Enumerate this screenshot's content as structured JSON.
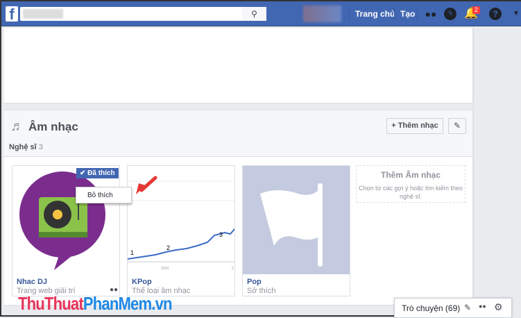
{
  "topbar": {
    "logo": "f",
    "home": "Trang chủ",
    "create": "Tạo",
    "notif_count": "2"
  },
  "music": {
    "title": "Âm nhạc",
    "add_label": "+ Thêm nhạc",
    "tab_label": "Nghệ sĩ",
    "tab_count": "3",
    "tiles": [
      {
        "name": "Nhac DJ",
        "sub": "Trang web giải trí"
      },
      {
        "name": "KPop",
        "sub": "Thể loại âm nhạc",
        "chart_labels": [
          "1",
          "2",
          "3"
        ],
        "axis_label": "2010",
        "axis_label2": "2"
      },
      {
        "name": "Pop",
        "sub": "Sở thích"
      }
    ],
    "add_tile": {
      "title": "Thêm Âm nhạc",
      "desc": "Chọn từ các gợi ý hoặc tìm kiếm theo nghệ sĩ."
    },
    "liked_label": "✔ Đã thích",
    "unlike_label": "Bỏ thích"
  },
  "watermark": {
    "part1": "ThuThuat",
    "part2": "PhanMem",
    "part3": ".vn"
  },
  "chat": {
    "label": "Trò chuyện (69)"
  }
}
